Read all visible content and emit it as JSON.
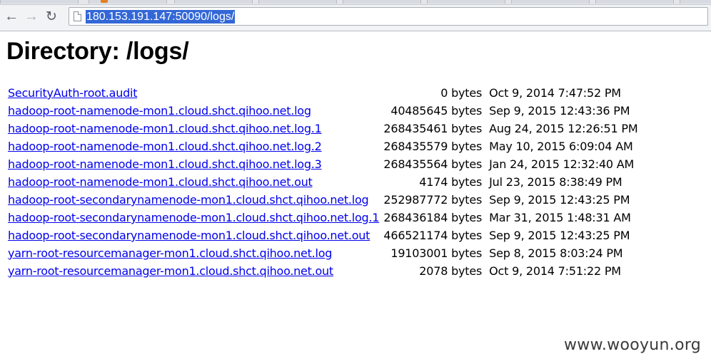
{
  "toolbar": {
    "back_icon": "arrow-left-icon",
    "forward_icon": "arrow-right-icon",
    "reload_icon": "reload-icon",
    "page_icon": "page-icon",
    "url": "180.153.191.147:50090/logs/"
  },
  "page": {
    "title": "Directory: /logs/"
  },
  "files": [
    {
      "name": "SecurityAuth-root.audit",
      "size": "0 bytes",
      "date": "Oct 9, 2014 7:47:52 PM"
    },
    {
      "name": "hadoop-root-namenode-mon1.cloud.shct.qihoo.net.log",
      "size": "40485645 bytes",
      "date": "Sep 9, 2015 12:43:36 PM"
    },
    {
      "name": "hadoop-root-namenode-mon1.cloud.shct.qihoo.net.log.1",
      "size": "268435461 bytes",
      "date": "Aug 24, 2015 12:26:51 PM"
    },
    {
      "name": "hadoop-root-namenode-mon1.cloud.shct.qihoo.net.log.2",
      "size": "268435579 bytes",
      "date": "May 10, 2015 6:09:04 AM"
    },
    {
      "name": "hadoop-root-namenode-mon1.cloud.shct.qihoo.net.log.3",
      "size": "268435564 bytes",
      "date": "Jan 24, 2015 12:32:40 AM"
    },
    {
      "name": "hadoop-root-namenode-mon1.cloud.shct.qihoo.net.out",
      "size": "4174 bytes",
      "date": "Jul 23, 2015 8:38:49 PM"
    },
    {
      "name": "hadoop-root-secondarynamenode-mon1.cloud.shct.qihoo.net.log",
      "size": "252987772 bytes",
      "date": "Sep 9, 2015 12:43:25 PM"
    },
    {
      "name": "hadoop-root-secondarynamenode-mon1.cloud.shct.qihoo.net.log.1",
      "size": "268436184 bytes",
      "date": "Mar 31, 2015 1:48:31 AM"
    },
    {
      "name": "hadoop-root-secondarynamenode-mon1.cloud.shct.qihoo.net.out",
      "size": "466521174 bytes",
      "date": "Sep 9, 2015 12:43:25 PM"
    },
    {
      "name": "yarn-root-resourcemanager-mon1.cloud.shct.qihoo.net.log",
      "size": "19103001 bytes",
      "date": "Sep 8, 2015 8:03:24 PM"
    },
    {
      "name": "yarn-root-resourcemanager-mon1.cloud.shct.qihoo.net.out",
      "size": "2078 bytes",
      "date": "Oct 9, 2014 7:51:22 PM"
    }
  ],
  "watermark": "www.wooyun.org",
  "colors": {
    "link": "#0000ee",
    "url_highlight": "#3367d6"
  }
}
